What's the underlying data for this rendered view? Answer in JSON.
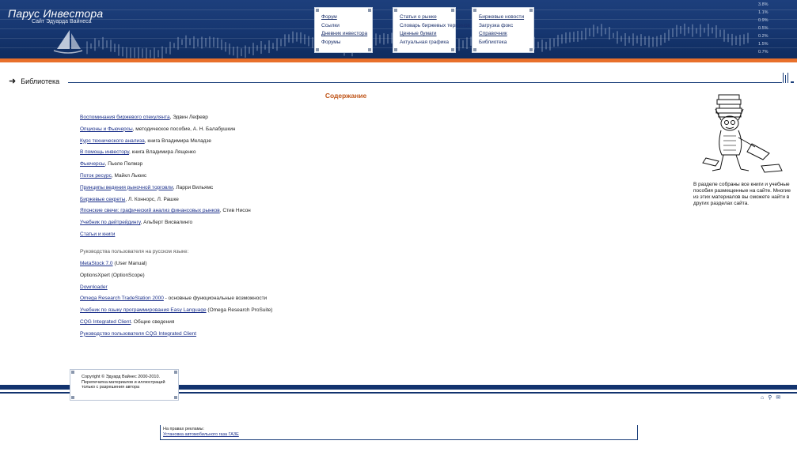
{
  "header": {
    "site_title": "Парус Инвестора",
    "site_subtitle": "Сайт Эдуарда Вайнеса",
    "menu1": [
      "Форум",
      "Ссылки",
      "Дневник инвестора",
      "Форумы"
    ],
    "menu2": [
      "Статьи о рынке",
      "Словарь биржевых терминов",
      "Ценные бумаги",
      "Актуальная графика"
    ],
    "menu3": [
      "Биржевые новости",
      "Загрузка фокс",
      "Справочник",
      "Библиотека"
    ],
    "ticker": [
      "3.8%",
      "1.1%",
      "0.9%",
      "0.5%",
      "0.2%",
      "1.5%",
      "0.7%"
    ]
  },
  "section": {
    "label": "Библиотека"
  },
  "content": {
    "title": "Содержание",
    "books": [
      {
        "link": "Воспоминания биржевого спекулянта",
        "author": ", Эдвин Лефевр"
      },
      {
        "link": "Опционы и Фьючерсы",
        "author": ", методическое пособие, А. Н. Балабушкин"
      },
      {
        "link": "Курс технического анализа",
        "author": ", книга Владимира Меладзе"
      },
      {
        "link": "В помощь инвестору",
        "author": ", книга Владимира Лященко"
      },
      {
        "link": "Фьючерсы",
        "author": ", Пьеле Пелмэр"
      },
      {
        "link": "Поток ресурс",
        "author": ", Майкл Льюис"
      },
      {
        "link": "Принципы ведения рыночной торговли",
        "author": ", Ларри Вильямс"
      },
      {
        "link": "Биржевые секреты",
        "author": ", Л. Коннорс, Л. Рашке"
      },
      {
        "link": "Японские свечи: графический анализ финансовых рынков",
        "author": ", Стив Нисон"
      },
      {
        "link": "Учебник по дейтрейдингу",
        "author": ", Альберт Висвалинго"
      },
      {
        "link": "Статьи и книги",
        "author": ""
      }
    ],
    "guides_label": "Руководства пользователя на русском языке:",
    "guides": [
      {
        "link": "MetaStock 7.0",
        "rest": " (User Manual)"
      },
      {
        "link": "OptionsXpert",
        "rest": " (OptionScope)"
      },
      {
        "link": "Downloader",
        "rest": ""
      },
      {
        "link": "Omega Research TradeStation 2000",
        "rest": " - основные функциональные возможности"
      },
      {
        "link": "Учебник по языку программирования Easy Language",
        "rest": " (Omega Research ProSuite)"
      },
      {
        "link": "CQG Integrated Client",
        "rest": ". Общие сведения"
      },
      {
        "link": "Руководство пользователя CQG Integrated Client",
        "rest": ""
      }
    ]
  },
  "sidebar": {
    "note": "В разделе собраны все книги и учебные пособия размещенные на сайте. Многие из этих материалов вы сможете найти в других разделах сайта."
  },
  "footer": {
    "copyright": "Copyright © Эдуард Вайнес 2000-2010. Перепечатка материалов и иллюстраций только с разрешения автора",
    "ad_header": "На правах рекламы:",
    "ad_link": "Установка автомобильного газа ГАЗЕ"
  },
  "colors": {
    "header_blue": "#163670",
    "accent_orange": "#e8702b",
    "title_orange": "#c0561a",
    "link_blue": "#1a2f8a"
  }
}
